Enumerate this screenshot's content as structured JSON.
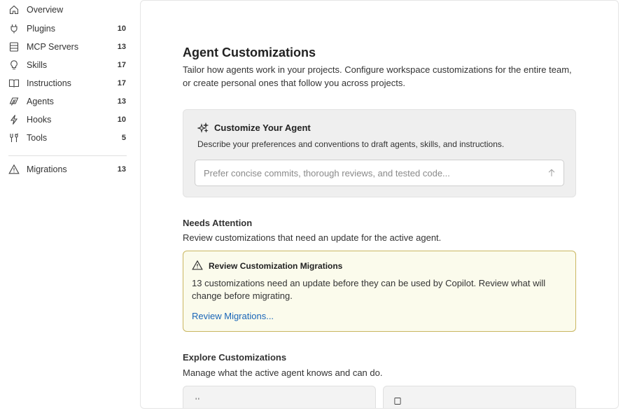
{
  "sidebar": {
    "items": [
      {
        "label": "Overview",
        "count": "",
        "icon": "home-icon"
      },
      {
        "label": "Plugins",
        "count": "10",
        "icon": "plug-icon"
      },
      {
        "label": "MCP Servers",
        "count": "13",
        "icon": "server-icon"
      },
      {
        "label": "Skills",
        "count": "17",
        "icon": "lightbulb-icon"
      },
      {
        "label": "Instructions",
        "count": "17",
        "icon": "book-icon"
      },
      {
        "label": "Agents",
        "count": "13",
        "icon": "agent-icon"
      },
      {
        "label": "Hooks",
        "count": "10",
        "icon": "lightning-icon"
      },
      {
        "label": "Tools",
        "count": "5",
        "icon": "tools-icon"
      }
    ],
    "migrations": {
      "label": "Migrations",
      "count": "13",
      "icon": "warning-icon"
    }
  },
  "main": {
    "title": "Agent Customizations",
    "description": "Tailor how agents work in your projects. Configure workspace customizations for the entire team, or create personal ones that follow you across projects.",
    "customize": {
      "title": "Customize Your Agent",
      "description": "Describe your preferences and conventions to draft agents, skills, and instructions.",
      "placeholder": "Prefer concise commits, thorough reviews, and tested code..."
    },
    "needs_attention": {
      "heading": "Needs Attention",
      "description": "Review customizations that need an update for the active agent.",
      "card": {
        "title": "Review Customization Migrations",
        "description": "13 customizations need an update before they can be used by Copilot. Review what will change before migrating.",
        "link": "Review Migrations..."
      }
    },
    "explore": {
      "heading": "Explore Customizations",
      "description": "Manage what the active agent knows and can do."
    }
  },
  "colors": {
    "accent_link": "#1a66b8",
    "warning_border": "#c9b660",
    "warning_bg": "#fbfbec"
  }
}
